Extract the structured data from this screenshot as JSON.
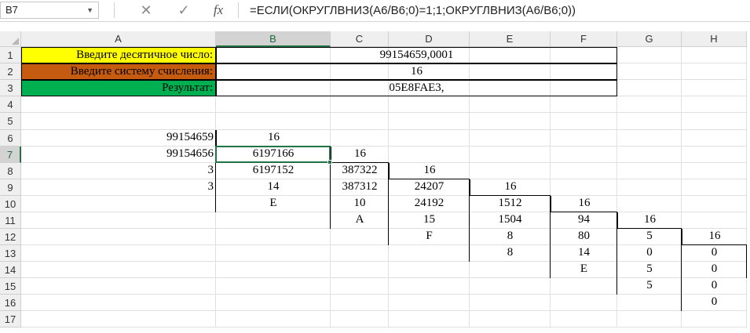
{
  "formula_bar": {
    "name_box": "B7",
    "cancel_glyph": "✕",
    "enter_glyph": "✓",
    "fx_glyph": "fx",
    "formula": "=ЕСЛИ(ОКРУГЛВНИЗ(A6/B6;0)=1;1;ОКРУГЛВНИЗ(A6/B6;0))"
  },
  "columns": [
    "A",
    "B",
    "C",
    "D",
    "E",
    "F",
    "G",
    "H"
  ],
  "rows": [
    "1",
    "2",
    "3",
    "4",
    "5",
    "6",
    "7",
    "8",
    "9",
    "10",
    "11",
    "12",
    "13",
    "14",
    "15",
    "16",
    "17"
  ],
  "header_cells": {
    "r1_label": "Введите десятичное число:",
    "r1_value": "99154659,0001",
    "r2_label": "Введите систему счисления:",
    "r2_value": "16",
    "r3_label": "Результат:",
    "r3_value": "05E8FAE3,"
  },
  "colors": {
    "r1_label_bg": "#ffff00",
    "r2_label_bg": "#c55a11",
    "r3_label_bg": "#00b050",
    "selection": "#217346"
  },
  "cells": {
    "A6": "99154659",
    "B6": "16",
    "A7": "99154656",
    "B7": "6197166",
    "C7": "16",
    "A8": "3",
    "B8": "6197152",
    "C8": "387322",
    "D8": "16",
    "A9": "3",
    "B9": "14",
    "C9": "387312",
    "D9": "24207",
    "E9": "16",
    "B10": "E",
    "C10": "10",
    "D10": "24192",
    "E10": "1512",
    "F10": "16",
    "C11": "A",
    "D11": "15",
    "E11": "1504",
    "F11": "94",
    "G11": "16",
    "D12": "F",
    "E12": "8",
    "F12": "80",
    "G12": "5",
    "H12": "16",
    "E13": "8",
    "F13": "14",
    "G13": "0",
    "H13": "0",
    "F14": "E",
    "G14": "5",
    "H14": "0",
    "G15": "5",
    "H15": "0",
    "H16": "0"
  }
}
